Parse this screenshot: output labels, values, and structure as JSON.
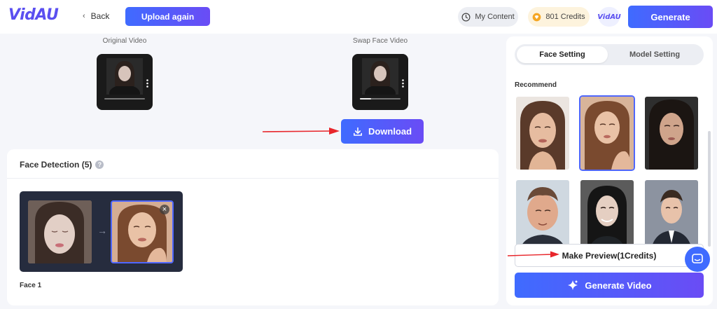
{
  "header": {
    "logo": "VidAU",
    "back_label": "Back",
    "upload_again_label": "Upload again",
    "my_content_label": "My Content",
    "credits_label": "801 Credits",
    "mini_logo": "VidAU",
    "generate_label": "Generate"
  },
  "videos": {
    "original_label": "Original Video",
    "swap_label": "Swap Face Video",
    "download_label": "Download"
  },
  "face_detection": {
    "title": "Face Detection (5)",
    "help": "?",
    "close": "×",
    "face_label": "Face 1"
  },
  "settings": {
    "tabs": [
      {
        "label": "Face Setting",
        "active": true
      },
      {
        "label": "Model Setting",
        "active": false
      }
    ],
    "recommend_label": "Recommend",
    "faces": [
      {
        "icon": "portrait-woman-1",
        "selected": false
      },
      {
        "icon": "portrait-woman-2",
        "selected": true
      },
      {
        "icon": "portrait-woman-3",
        "selected": false
      },
      {
        "icon": "portrait-man-1",
        "selected": false
      },
      {
        "icon": "portrait-man-2",
        "selected": false
      },
      {
        "icon": "portrait-man-3",
        "selected": false
      }
    ],
    "make_preview_label": "Make Preview(1Credits)",
    "generate_video_label": "Generate Video"
  },
  "colors": {
    "accent": "#4f67ff",
    "annotation": "#e8262b"
  }
}
